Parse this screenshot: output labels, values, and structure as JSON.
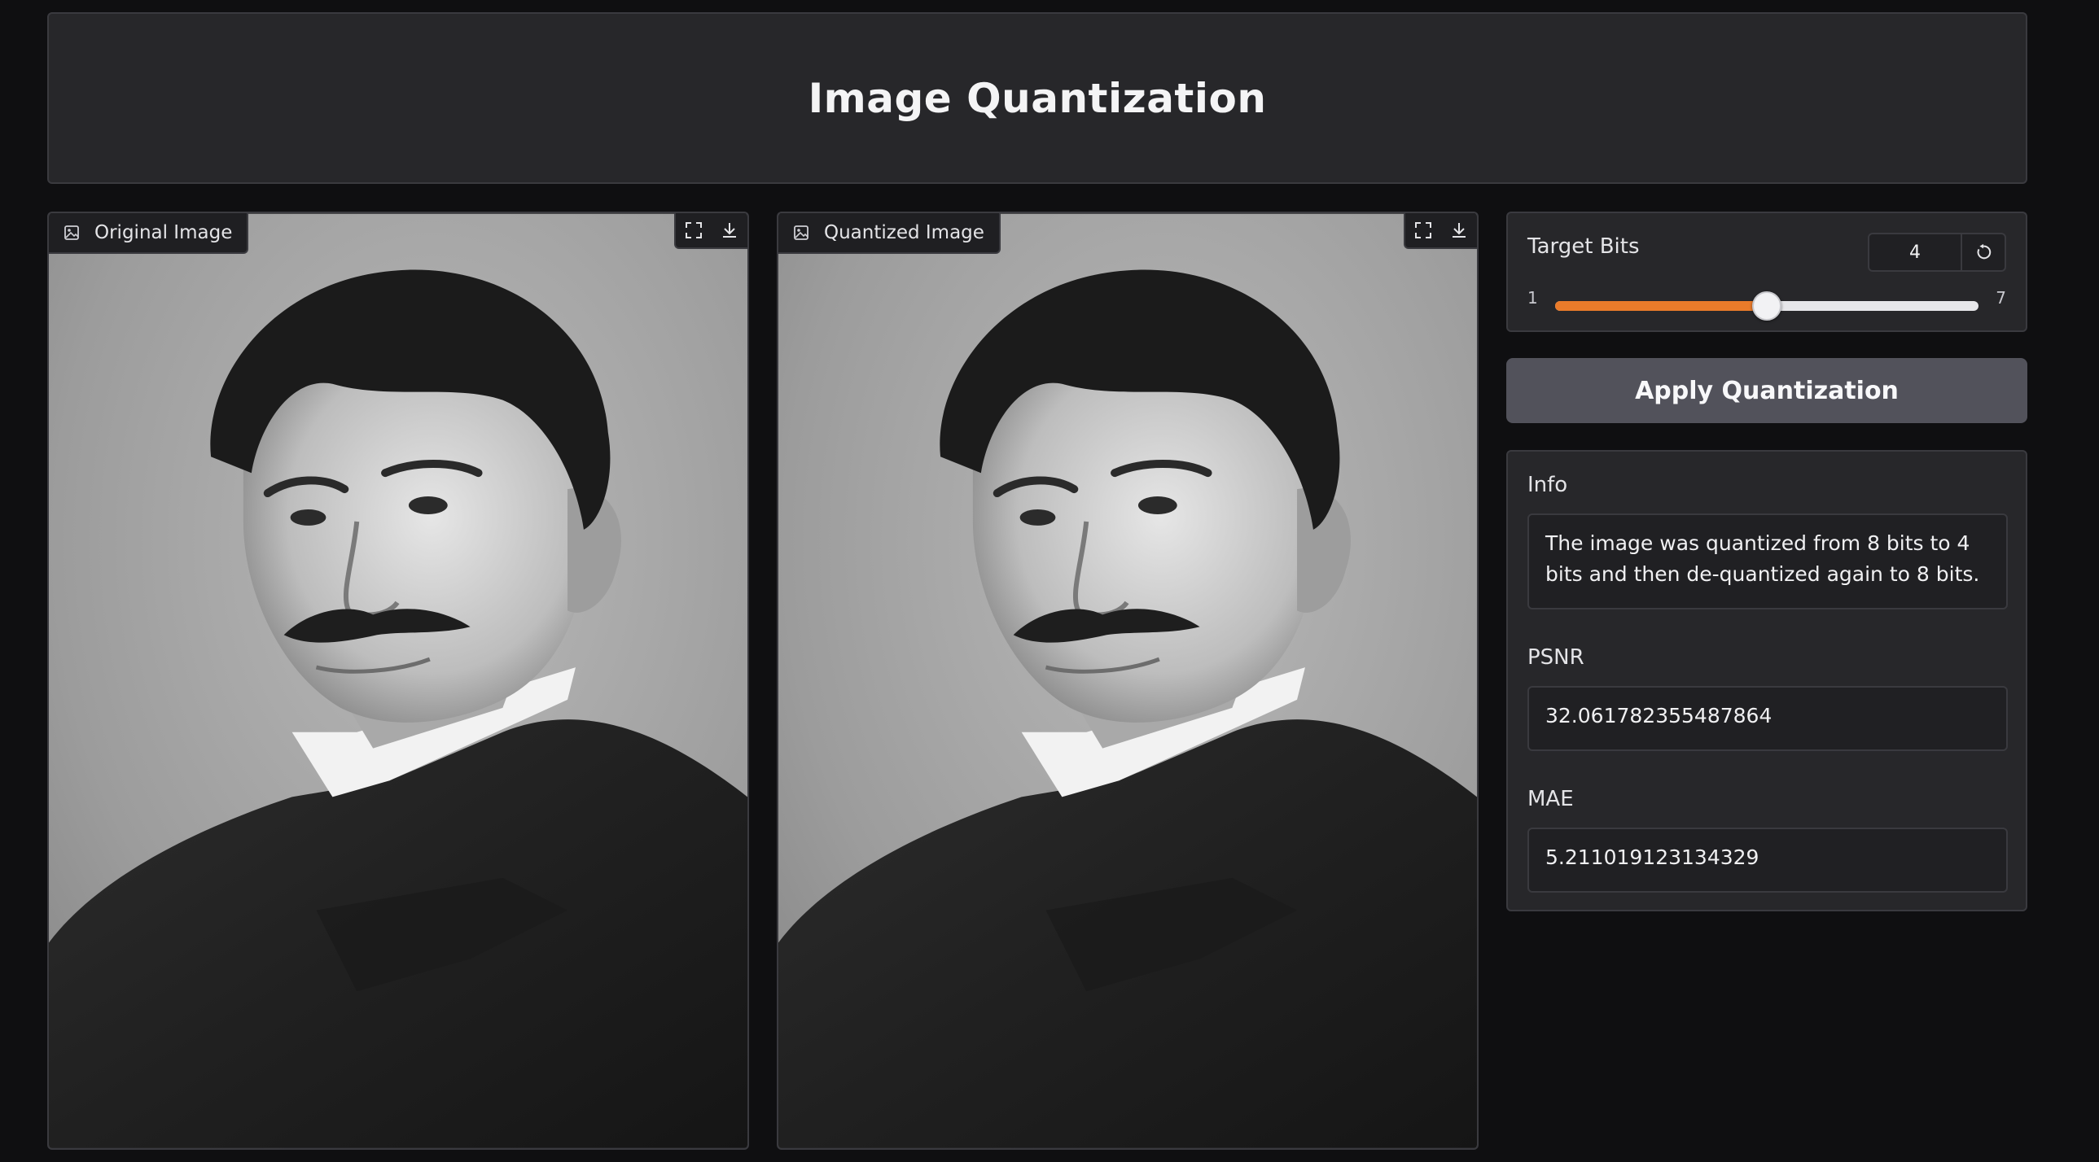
{
  "header": {
    "title": "Image Quantization"
  },
  "panels": {
    "original": {
      "label": "Original Image"
    },
    "quantized": {
      "label": "Quantized Image"
    }
  },
  "icons": {
    "image": "image-icon",
    "fullscreen": "fullscreen-icon",
    "download": "download-icon",
    "reset": "reset-icon"
  },
  "controls": {
    "label": "Target Bits",
    "value": "4",
    "min": "1",
    "max": "7",
    "level": 4
  },
  "apply_button": {
    "label": "Apply Quantization"
  },
  "info": {
    "label": "Info",
    "text": "The image was quantized from 8 bits to 4 bits and then de-quantized again to 8 bits.",
    "psnr_label": "PSNR",
    "psnr_value": "32.061782355487864",
    "mae_label": "MAE",
    "mae_value": "5.211019123134329"
  },
  "colors": {
    "accent": "#ea7b2a",
    "button": "#52525b",
    "card": "#27272a",
    "background": "#0f0f11"
  }
}
